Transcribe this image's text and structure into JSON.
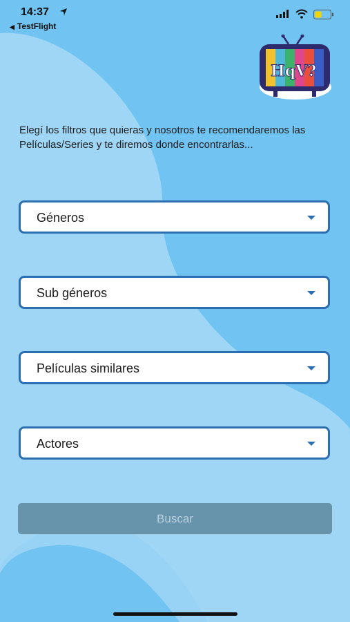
{
  "status_bar": {
    "time": "14:37",
    "back_app": "TestFlight"
  },
  "logo": {
    "text": "HqV?",
    "description": "retro tv logo with rainbow screen"
  },
  "intro_text": "Elegí los filtros que quieras y nosotros te recomendaremos las Películas/Series y te diremos donde encontrarlas...",
  "filters": {
    "generos": "Géneros",
    "subgeneros": "Sub géneros",
    "peliculas_similares": "Películas similares",
    "actores": "Actores"
  },
  "search_button": "Buscar",
  "colors": {
    "background": "#71c3f1",
    "background_light": "#9fd6f6",
    "accent": "#2c6fb1",
    "button_disabled": "#6793ab"
  }
}
